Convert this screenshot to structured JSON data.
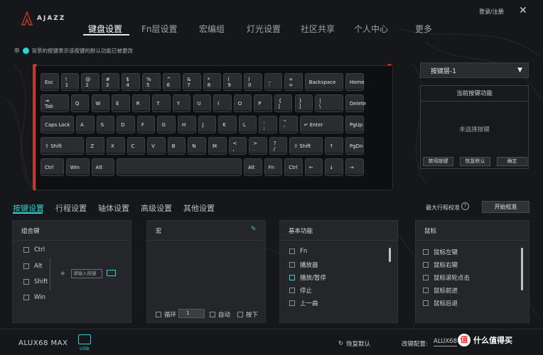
{
  "header": {
    "brand": "AJAZZ",
    "login": "登录/注册",
    "nav": [
      "键盘设置",
      "Fn层设置",
      "宏编组",
      "灯光设置",
      "社区共享",
      "个人中心",
      "更多"
    ],
    "active_nav": "键盘设置"
  },
  "note": {
    "prefix": "带",
    "text": "背景的按键表示该按键的默认功能已被更改"
  },
  "keyboard": {
    "row1": [
      {
        "t": "Esc",
        "b": ""
      },
      {
        "t": "!",
        "b": "1"
      },
      {
        "t": "@",
        "b": "2"
      },
      {
        "t": "#",
        "b": "3"
      },
      {
        "t": "$",
        "b": "4"
      },
      {
        "t": "%",
        "b": "5"
      },
      {
        "t": "^",
        "b": "6"
      },
      {
        "t": "&",
        "b": "7"
      },
      {
        "t": "*",
        "b": "8"
      },
      {
        "t": "(",
        "b": "9"
      },
      {
        "t": ")",
        "b": "0"
      },
      {
        "t": "_",
        "b": "-"
      },
      {
        "t": "+",
        "b": "="
      },
      {
        "t": "Backspace",
        "b": ""
      },
      {
        "t": "Home",
        "b": ""
      }
    ],
    "row2": [
      {
        "t": "⇥",
        "b": "Tab"
      },
      {
        "t": "Q",
        "b": ""
      },
      {
        "t": "W",
        "b": ""
      },
      {
        "t": "E",
        "b": ""
      },
      {
        "t": "R",
        "b": ""
      },
      {
        "t": "T",
        "b": ""
      },
      {
        "t": "Y",
        "b": ""
      },
      {
        "t": "U",
        "b": ""
      },
      {
        "t": "I",
        "b": ""
      },
      {
        "t": "O",
        "b": ""
      },
      {
        "t": "P",
        "b": ""
      },
      {
        "t": "{",
        "b": "["
      },
      {
        "t": "}",
        "b": "]"
      },
      {
        "t": "|",
        "b": "\\"
      },
      {
        "t": "Delete",
        "b": ""
      }
    ],
    "row3": [
      {
        "t": "Caps Lock",
        "b": ""
      },
      {
        "t": "A",
        "b": ""
      },
      {
        "t": "S",
        "b": ""
      },
      {
        "t": "D",
        "b": ""
      },
      {
        "t": "F",
        "b": ""
      },
      {
        "t": "G",
        "b": ""
      },
      {
        "t": "H",
        "b": ""
      },
      {
        "t": "J",
        "b": ""
      },
      {
        "t": "K",
        "b": ""
      },
      {
        "t": "L",
        "b": ""
      },
      {
        "t": ":",
        "b": ";"
      },
      {
        "t": "\"",
        "b": "'"
      },
      {
        "t": "↵ Enter",
        "b": ""
      },
      {
        "t": "PgUp",
        "b": ""
      }
    ],
    "row4": [
      {
        "t": "⇧ Shift",
        "b": ""
      },
      {
        "t": "Z",
        "b": ""
      },
      {
        "t": "X",
        "b": ""
      },
      {
        "t": "C",
        "b": ""
      },
      {
        "t": "V",
        "b": ""
      },
      {
        "t": "B",
        "b": ""
      },
      {
        "t": "N",
        "b": ""
      },
      {
        "t": "M",
        "b": ""
      },
      {
        "t": "<",
        "b": ","
      },
      {
        "t": ">",
        "b": "."
      },
      {
        "t": "?",
        "b": "/"
      },
      {
        "t": "⇧ Shift",
        "b": ""
      },
      {
        "t": "↑",
        "b": ""
      },
      {
        "t": "PgDn",
        "b": ""
      }
    ],
    "row5": [
      {
        "t": "Ctrl",
        "b": ""
      },
      {
        "t": "Win",
        "b": ""
      },
      {
        "t": "Alt",
        "b": ""
      },
      {
        "t": "",
        "b": ""
      },
      {
        "t": "Alt",
        "b": ""
      },
      {
        "t": "Fn",
        "b": ""
      },
      {
        "t": "Ctrl",
        "b": ""
      },
      {
        "t": "←",
        "b": ""
      },
      {
        "t": "↓",
        "b": ""
      },
      {
        "t": "→",
        "b": ""
      }
    ]
  },
  "right_panel": {
    "layer": "按键层-1",
    "func_title": "当前按键功能",
    "func_empty": "未选择按键",
    "buttons": [
      "禁用按键",
      "恢复默认",
      "确定"
    ]
  },
  "tabs": [
    "按键设置",
    "行程设置",
    "轴体设置",
    "高级设置",
    "其他设置"
  ],
  "calibration": {
    "label": "最大行程校准",
    "help": "?",
    "button": "开始校准"
  },
  "combo": {
    "title": "组合键",
    "mods": [
      "Ctrl",
      "Alt",
      "Shift",
      "Win"
    ],
    "plus": "+",
    "input_placeholder": "请输入按键"
  },
  "macro": {
    "title": "宏",
    "loop_label": "循环",
    "loop_value": "1",
    "auto_label": "自动",
    "press_label": "按下"
  },
  "basic": {
    "title": "基本功能",
    "items": [
      "Fn",
      "播放器",
      "播放/暂停",
      "停止",
      "上一曲"
    ]
  },
  "mouse": {
    "title": "鼠标",
    "items": [
      "鼠标左键",
      "鼠标右键",
      "鼠标滚轮点击",
      "鼠标前进",
      "鼠标后退"
    ]
  },
  "footer": {
    "model": "ALUX68 MAX",
    "usb": "USB",
    "restore": "恢复默认",
    "config_label": "改键配置:",
    "config_value": "ALUX68",
    "watermark": "什么值得买"
  },
  "colors": {
    "accent": "#2fd4d0",
    "frame_red": "#c0392b",
    "background": "#15171a"
  }
}
